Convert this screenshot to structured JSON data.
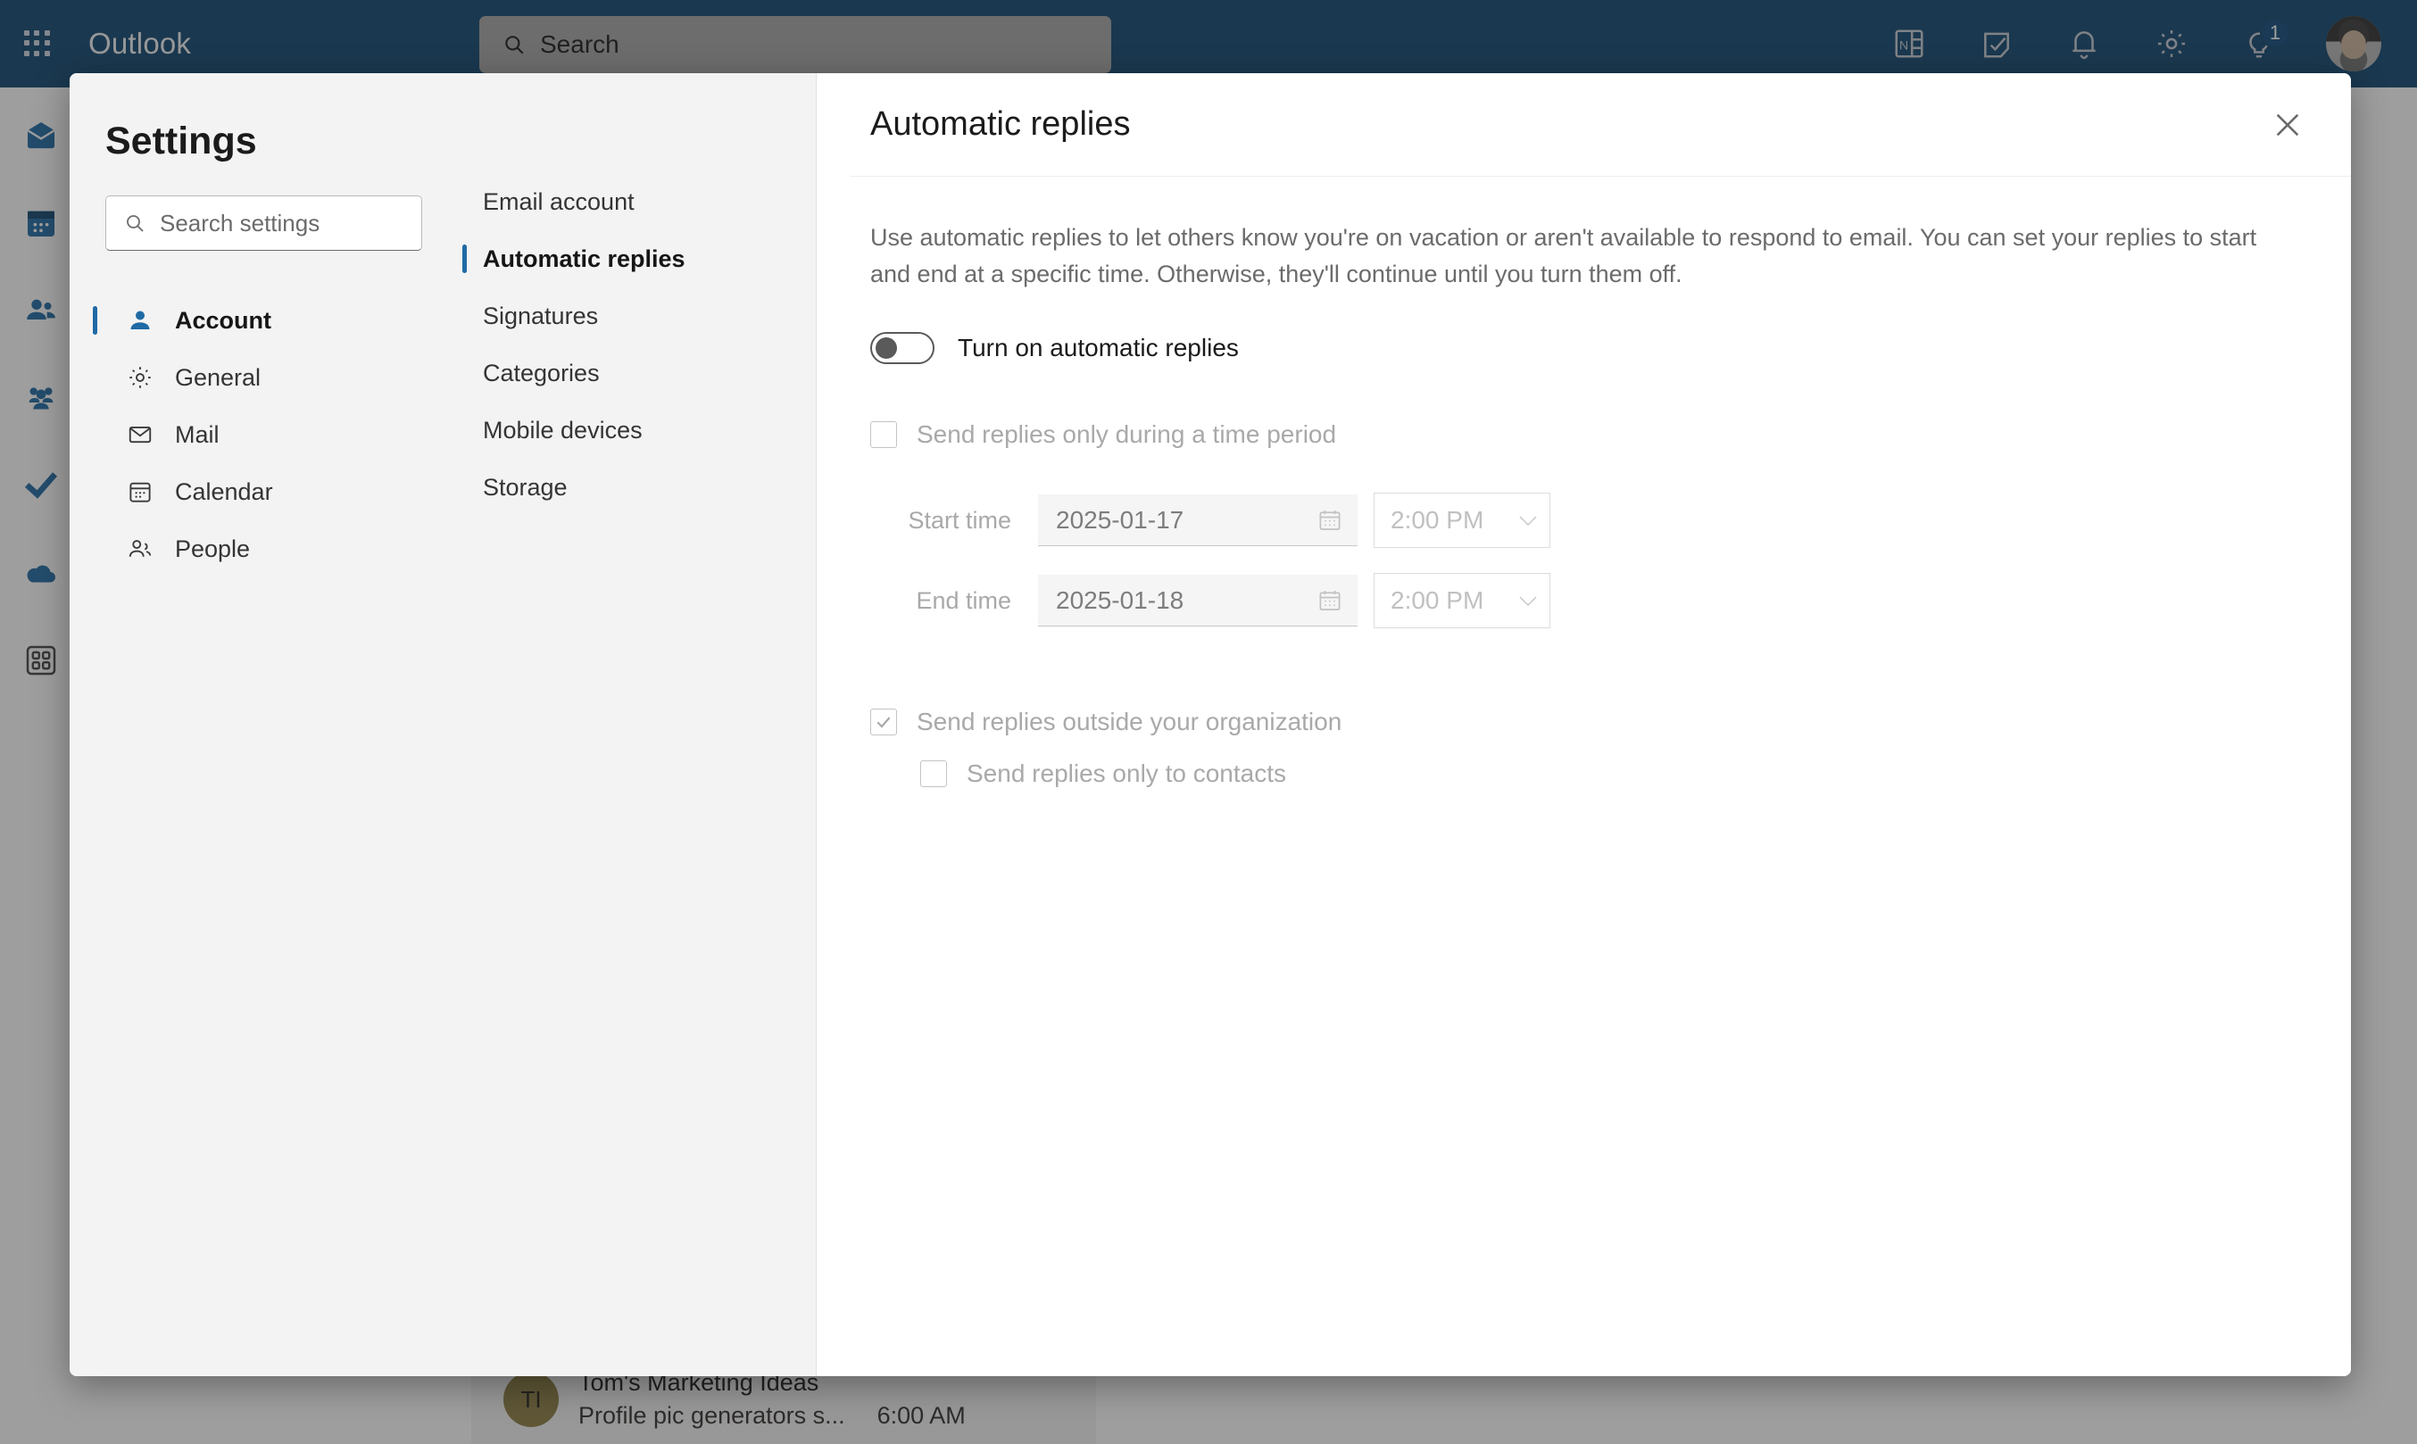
{
  "topbar": {
    "brand": "Outlook",
    "search_placeholder": "Search",
    "waffle_icon": "app-launcher-icon",
    "icons": [
      {
        "name": "onenote-icon",
        "glyph": "N"
      },
      {
        "name": "notes-icon",
        "glyph": ""
      },
      {
        "name": "notifications-bell-icon",
        "glyph": ""
      },
      {
        "name": "settings-gear-icon",
        "glyph": ""
      },
      {
        "name": "tips-lightbulb-icon",
        "badge": "1"
      }
    ],
    "avatar_label": ""
  },
  "rail": {
    "items": [
      {
        "name": "mail",
        "selected": true
      },
      {
        "name": "calendar",
        "selected": false
      },
      {
        "name": "people",
        "selected": false
      },
      {
        "name": "groups",
        "selected": false
      },
      {
        "name": "todo",
        "selected": false
      },
      {
        "name": "onedrive",
        "selected": false
      },
      {
        "name": "apps",
        "selected": false
      }
    ]
  },
  "background": {
    "mail_item": {
      "avatar_initials": "TI",
      "sender": "Tom's Marketing Ideas",
      "preview": "Profile pic generators s...",
      "time": "6:00 AM"
    }
  },
  "dialog": {
    "title": "Settings",
    "search_placeholder": "Search settings",
    "close_label": "Close",
    "categories": [
      {
        "label": "Account",
        "icon": "person-icon",
        "selected": true
      },
      {
        "label": "General",
        "icon": "gear-icon",
        "selected": false
      },
      {
        "label": "Mail",
        "icon": "envelope-icon",
        "selected": false
      },
      {
        "label": "Calendar",
        "icon": "calendar-icon",
        "selected": false
      },
      {
        "label": "People",
        "icon": "people-icon",
        "selected": false
      }
    ],
    "subcategories": [
      {
        "label": "Email account",
        "selected": false
      },
      {
        "label": "Automatic replies",
        "selected": true
      },
      {
        "label": "Signatures",
        "selected": false
      },
      {
        "label": "Categories",
        "selected": false
      },
      {
        "label": "Mobile devices",
        "selected": false
      },
      {
        "label": "Storage",
        "selected": false
      }
    ],
    "panel": {
      "title": "Automatic replies",
      "description": "Use automatic replies to let others know you're on vacation or aren't available to respond to email. You can set your replies to start and end at a specific time. Otherwise, they'll continue until you turn them off.",
      "toggle": {
        "label": "Turn on automatic replies",
        "state": "off"
      },
      "time_period": {
        "checkbox_label": "Send replies only during a time period",
        "checked": false,
        "disabled": true,
        "start": {
          "label": "Start time",
          "date": "2025-01-17",
          "time": "2:00 PM"
        },
        "end": {
          "label": "End time",
          "date": "2025-01-18",
          "time": "2:00 PM"
        }
      },
      "outside_org": {
        "label": "Send replies outside your organization",
        "checked": true,
        "disabled": true
      },
      "contacts_only": {
        "label": "Send replies only to contacts",
        "checked": false,
        "disabled": true
      }
    }
  },
  "colors": {
    "brand_blue": "#10456f",
    "accent_blue": "#1f6aa5",
    "panel_bg": "#f3f3f3",
    "disabled_text": "#a9a9a9"
  }
}
